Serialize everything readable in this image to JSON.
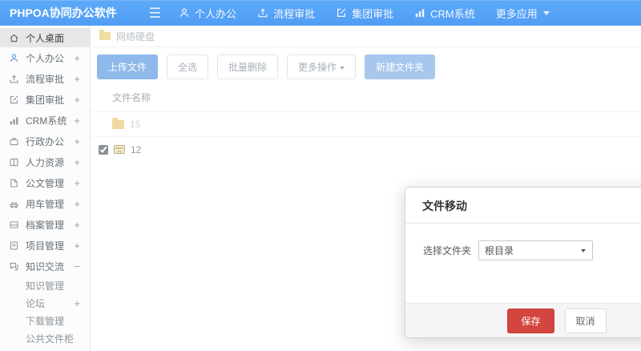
{
  "topbar": {
    "logo": "PHPOA协同办公软件",
    "items": [
      {
        "label": "个人办公",
        "icon": "user-icon"
      },
      {
        "label": "流程审批",
        "icon": "workflow-icon"
      },
      {
        "label": "集团审批",
        "icon": "edit-icon"
      },
      {
        "label": "CRM系统",
        "icon": "bar-chart-icon"
      },
      {
        "label": "更多应用",
        "icon": "caret-down-icon"
      }
    ]
  },
  "sidebar": {
    "items": [
      {
        "label": "个人桌面",
        "expand": ""
      },
      {
        "label": "个人办公",
        "expand": "+"
      },
      {
        "label": "流程审批",
        "expand": "+"
      },
      {
        "label": "集团审批",
        "expand": "+"
      },
      {
        "label": "CRM系统",
        "expand": "+"
      },
      {
        "label": "行政办公",
        "expand": "+"
      },
      {
        "label": "人力资源",
        "expand": "+"
      },
      {
        "label": "公文管理",
        "expand": "+"
      },
      {
        "label": "用车管理",
        "expand": "+"
      },
      {
        "label": "档案管理",
        "expand": "+"
      },
      {
        "label": "项目管理",
        "expand": "+"
      },
      {
        "label": "知识交流",
        "expand": "−"
      }
    ],
    "sub_items": [
      {
        "label": "知识管理",
        "expand": ""
      },
      {
        "label": "论坛",
        "expand": "+"
      },
      {
        "label": "下载管理",
        "expand": ""
      },
      {
        "label": "公共文件柜",
        "expand": ""
      }
    ]
  },
  "breadcrumb": {
    "label": "网络硬盘"
  },
  "toolbar": {
    "upload": "上传文件",
    "select_all": "全选",
    "batch_delete": "批量删除",
    "more_ops": "更多操作",
    "new_folder": "新建文件夹"
  },
  "file_table": {
    "header": "文件名称",
    "rows": [
      {
        "name": "15",
        "type": "folder",
        "checked": false
      },
      {
        "name": "12",
        "type": "archive",
        "checked": true
      }
    ]
  },
  "modal": {
    "title": "文件移动",
    "folder_label": "选择文件夹",
    "folder_value": "根目录",
    "save": "保存",
    "cancel": "取消"
  },
  "colors": {
    "topbar_blue": "#55a2f6",
    "accent_light_blue": "#8fb9ea",
    "danger_red": "#d4453f",
    "folder_yellow": "#efd9a0"
  }
}
